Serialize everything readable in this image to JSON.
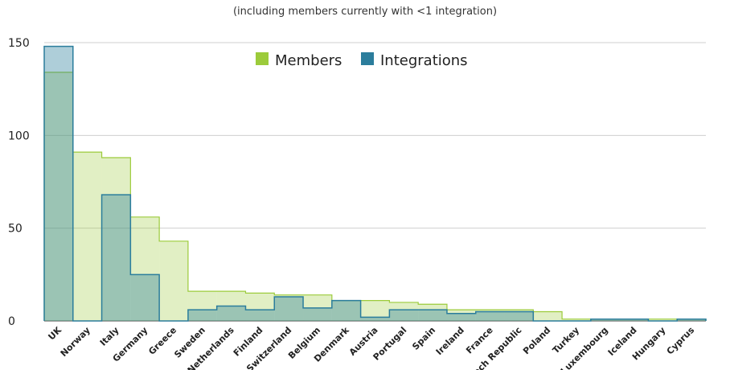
{
  "chart_data": {
    "type": "area",
    "title": "",
    "subtitle": "(including members currently with <1 integration)",
    "xlabel": "",
    "ylabel": "",
    "ylim": [
      0,
      150
    ],
    "yticks": [
      0,
      50,
      100,
      150
    ],
    "grid": true,
    "legend_position": "top-center",
    "categories": [
      "UK",
      "Norway",
      "Italy",
      "Germany",
      "Greece",
      "Sweden",
      "Netherlands",
      "Finland",
      "Switzerland",
      "Belgium",
      "Denmark",
      "Austria",
      "Portugal",
      "Spain",
      "Ireland",
      "France",
      "Czech Republic",
      "Poland",
      "Turkey",
      "Luxembourg",
      "Iceland",
      "Hungary",
      "Cyprus"
    ],
    "series": [
      {
        "name": "Members",
        "color": "#9ccb3b",
        "values": [
          134,
          91,
          88,
          56,
          43,
          16,
          16,
          15,
          14,
          14,
          11,
          11,
          10,
          9,
          6,
          6,
          6,
          5,
          1,
          1,
          1,
          1,
          1
        ]
      },
      {
        "name": "Integrations",
        "color": "#2b7d9c",
        "values": [
          148,
          0,
          68,
          25,
          0,
          6,
          8,
          6,
          13,
          7,
          11,
          2,
          6,
          6,
          4,
          5,
          5,
          0,
          0,
          1,
          1,
          0,
          1
        ]
      }
    ]
  }
}
